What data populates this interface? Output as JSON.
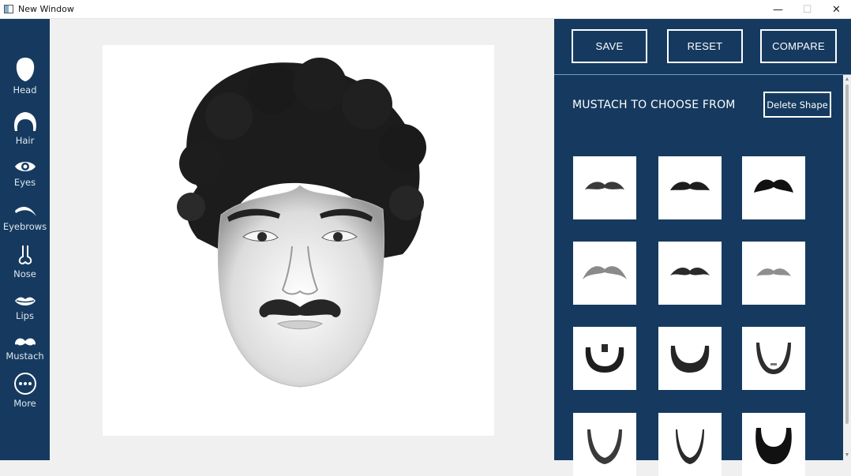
{
  "window": {
    "title": "New Window",
    "minimize": "—",
    "maximize": "☐",
    "close": "✕"
  },
  "sidebar": {
    "items": [
      {
        "label": "Head",
        "icon": "head-icon"
      },
      {
        "label": "Hair",
        "icon": "hair-icon"
      },
      {
        "label": "Eyes",
        "icon": "eye-icon"
      },
      {
        "label": "Eyebrows",
        "icon": "eyebrow-icon"
      },
      {
        "label": "Nose",
        "icon": "nose-icon"
      },
      {
        "label": "Lips",
        "icon": "lips-icon"
      },
      {
        "label": "Mustach",
        "icon": "mustache-icon"
      },
      {
        "label": "More",
        "icon": "more-icon"
      }
    ]
  },
  "toolbar": {
    "save": "SAVE",
    "reset": "RESET",
    "compare": "COMPARE"
  },
  "panel": {
    "section_title": "MUSTACH TO CHOOSE FROM",
    "delete_label": "Delete Shape",
    "shapes": [
      "mustache-1",
      "mustache-2",
      "mustache-3",
      "mustache-4",
      "mustache-5",
      "mustache-6",
      "beard-1",
      "beard-2",
      "beard-3",
      "beard-4",
      "beard-5",
      "beard-6"
    ]
  },
  "colors": {
    "sidebar": "#163a5f",
    "panel": "#163a5f",
    "accent_line": "#6aa2c8"
  }
}
